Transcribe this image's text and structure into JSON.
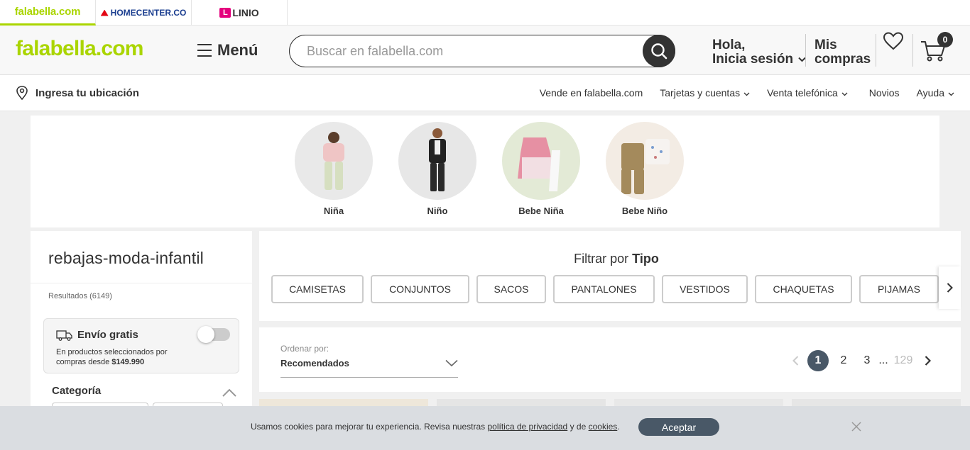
{
  "brands": [
    {
      "label": "falabella.com"
    },
    {
      "label": "HOMECENTER.CO"
    },
    {
      "label": "LINIO"
    }
  ],
  "header": {
    "logo": "falabella.com",
    "menu_label": "Menú",
    "search_placeholder": "Buscar en falabella.com",
    "login_line1": "Hola,",
    "login_line2": "Inicia sesión",
    "compras_line1": "Mis",
    "compras_line2": "compras",
    "cart_count": "0"
  },
  "subnav": {
    "location": "Ingresa tu ubicación",
    "links": [
      "Vende en falabella.com",
      "Tarjetas y cuentas",
      "Venta telefónica",
      "Novios",
      "Ayuda"
    ]
  },
  "circles": [
    "Niña",
    "Niño",
    "Bebe Niña",
    "Bebe Niño"
  ],
  "sidebar": {
    "title": "rebajas-moda-infantil",
    "results": "Resultados (6149)",
    "envio_title": "Envío gratis",
    "envio_desc": "En productos seleccionados por compras desde",
    "envio_amount": "$149.990",
    "envio_enabled": false,
    "categoria": "Categoría"
  },
  "filter": {
    "title_prefix": "Filtrar por",
    "title_bold": "Tipo",
    "chips": [
      "CAMISETAS",
      "CONJUNTOS",
      "SACOS",
      "PANTALONES",
      "VESTIDOS",
      "CHAQUETAS",
      "PIJAMAS"
    ]
  },
  "sort": {
    "label": "Ordenar por:",
    "value": "Recomendados"
  },
  "pagination": {
    "pages": [
      "1",
      "2",
      "3"
    ],
    "ellipsis": "...",
    "last": "129",
    "current": "1"
  },
  "cookie": {
    "text_before": "Usamos cookies para mejorar tu experiencia. Revisa nuestras",
    "link1": "política de privacidad",
    "text_mid": "y de",
    "link2": "cookies",
    "text_end": ".",
    "accept": "Aceptar"
  },
  "colors": {
    "brand_green": "#aad500",
    "dark": "#333333",
    "accent_slate": "#495867"
  }
}
